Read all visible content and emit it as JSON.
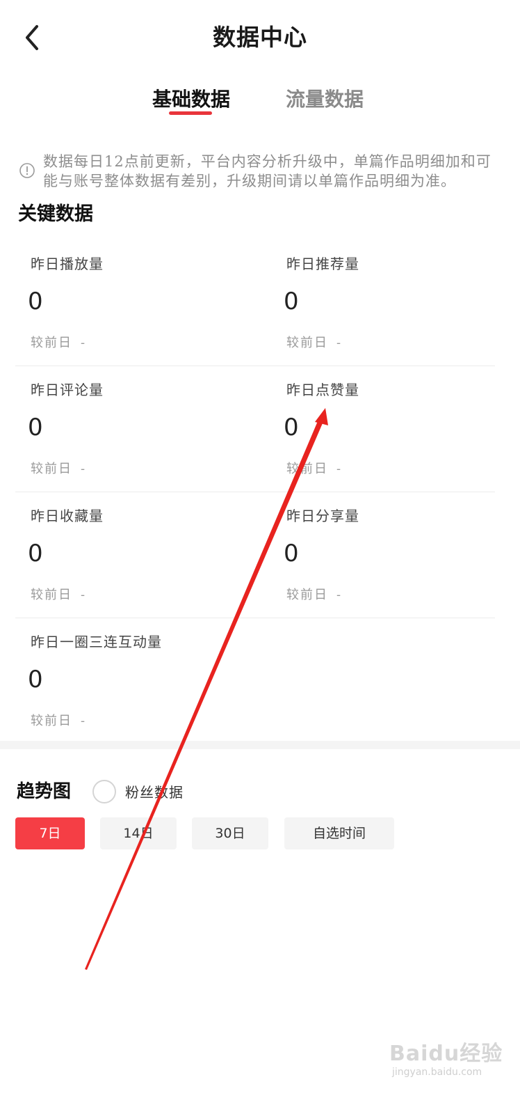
{
  "header": {
    "title": "数据中心"
  },
  "tabs": [
    {
      "label": "基础数据",
      "active": true
    },
    {
      "label": "流量数据",
      "active": false
    }
  ],
  "notice": {
    "text": "数据每日12点前更新，平台内容分析升级中，单篇作品明细加和可能与账号整体数据有差别，升级期间请以单篇作品明细为准。"
  },
  "key_data": {
    "title": "关键数据",
    "metrics": [
      {
        "label": "昨日播放量",
        "value": "0",
        "compare_label": "较前日",
        "compare_value": "-"
      },
      {
        "label": "昨日推荐量",
        "value": "0",
        "compare_label": "较前日",
        "compare_value": "-"
      },
      {
        "label": "昨日评论量",
        "value": "0",
        "compare_label": "较前日",
        "compare_value": "-"
      },
      {
        "label": "昨日点赞量",
        "value": "0",
        "compare_label": "较前日",
        "compare_value": "-"
      },
      {
        "label": "昨日收藏量",
        "value": "0",
        "compare_label": "较前日",
        "compare_value": "-"
      },
      {
        "label": "昨日分享量",
        "value": "0",
        "compare_label": "较前日",
        "compare_value": "-"
      },
      {
        "label": "昨日一圈三连互动量",
        "value": "0",
        "compare_label": "较前日",
        "compare_value": "-"
      }
    ]
  },
  "trend": {
    "title": "趋势图",
    "fans_toggle_label": "粉丝数据",
    "ranges": [
      {
        "label": "7日",
        "selected": true
      },
      {
        "label": "14日",
        "selected": false
      },
      {
        "label": "30日",
        "selected": false
      },
      {
        "label": "自选时间",
        "selected": false
      }
    ]
  },
  "colors": {
    "accent": "#f53e45",
    "tab_underline": "#e8353b",
    "annotation_arrow": "#e8231f",
    "muted_text": "#8d8d8d"
  },
  "icons": {
    "back": "chevron-left-icon",
    "notice": "info-circle-icon"
  },
  "watermark": {
    "main": "Baidu经验",
    "sub": "jingyan.baidu.com"
  }
}
